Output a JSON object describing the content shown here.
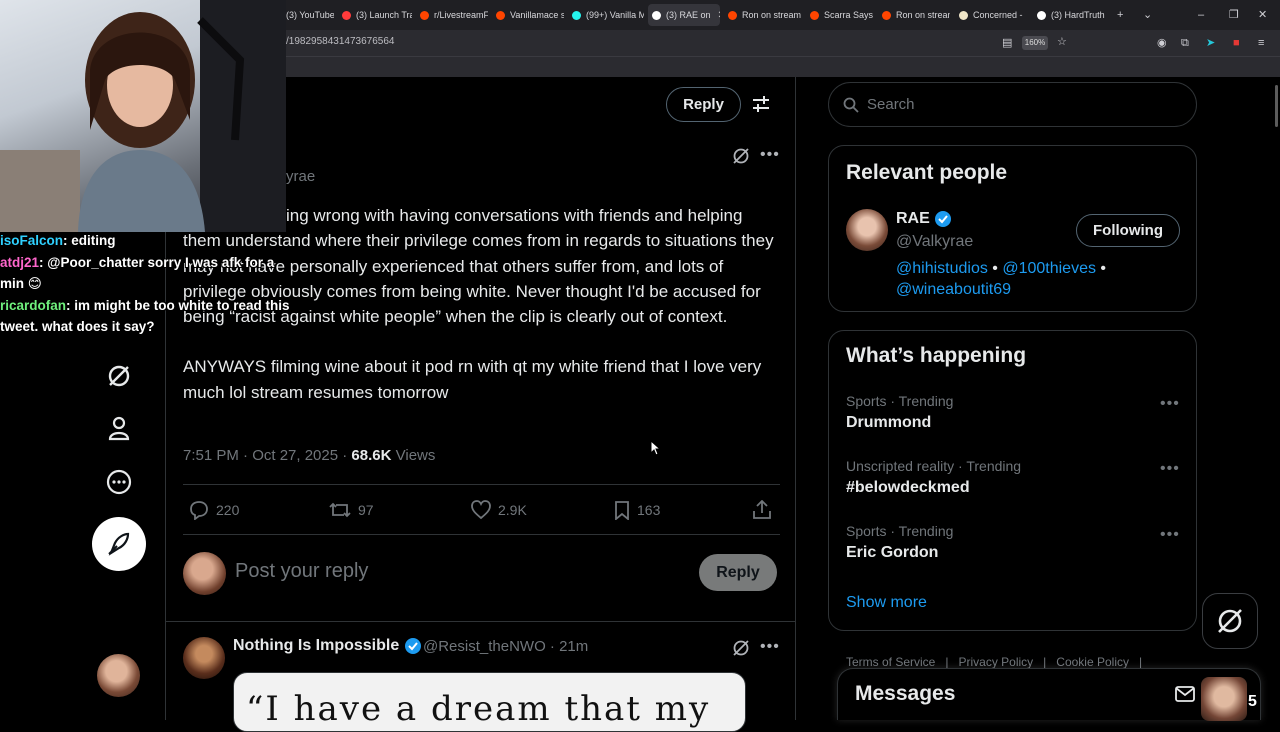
{
  "browser": {
    "tabs": [
      {
        "label": "(3) YouTube",
        "color": "#ff0000"
      },
      {
        "label": "(3) Launch Tra",
        "color": "#ff3b3b"
      },
      {
        "label": "r/LivestreamF",
        "color": "#ff4500"
      },
      {
        "label": "Vanillamace s",
        "color": "#ff4500"
      },
      {
        "label": "(99+) Vanilla M",
        "color": "#25f4ee"
      },
      {
        "label": "(3) RAE on",
        "color": "#ffffff"
      },
      {
        "label": "Ron on stream",
        "color": "#ff4500"
      },
      {
        "label": "Scarra Says H",
        "color": "#ff4500"
      },
      {
        "label": "Ron on stream",
        "color": "#ff4500"
      },
      {
        "label": "Concerned - ",
        "color": "#f0e6c8"
      },
      {
        "label": "(3) HardTruth",
        "color": "#ffffff"
      }
    ],
    "url": "/1982958431473676564",
    "zoom": "160%"
  },
  "header": {
    "reply_label": "Reply"
  },
  "tweet": {
    "handle_partial": "yrae",
    "paragraph1": "ing wrong with having conversations with friends and helping them understand where their privilege comes from in regards to situations they may not have personally experienced that others suffer from, and lots of privilege obviously comes from being white. Never thought I'd be accused for being “racist against white people” when the clip is clearly out of context.",
    "paragraph2": "ANYWAYS filming wine about it pod rn with qt my white friend that I love very much lol stream resumes tomorrow",
    "time": "7:51 PM · Oct 27, 2025 ·",
    "views_count": "68.6K",
    "views_label": "Views",
    "stats": {
      "replies": "220",
      "reposts": "97",
      "likes": "2.9K",
      "bookmarks": "163"
    }
  },
  "composer": {
    "placeholder": "Post your reply",
    "submit_label": "Reply"
  },
  "reply2": {
    "name": "Nothing Is Impossible",
    "handle_time": "@Resist_theNWO · 21m",
    "media_text": "“I have a dream that my"
  },
  "search": {
    "placeholder": "Search"
  },
  "relevant_people": {
    "title": "Relevant people",
    "name": "RAE",
    "handle": "@Valkyrae",
    "bio_links": [
      "@hihistudios",
      "@100thieves",
      "@wineaboutit69"
    ],
    "bio_separator": " • ",
    "follow_label": "Following"
  },
  "whats_happening": {
    "title": "What’s happening",
    "trends": [
      {
        "category": "Sports · Trending",
        "name": "Drummond"
      },
      {
        "category": "Unscripted reality · Trending",
        "name": "#belowdeckmed"
      },
      {
        "category": "Sports · Trending",
        "name": "Eric Gordon"
      }
    ],
    "show_more": "Show more"
  },
  "footer": [
    "Terms of Service",
    "|",
    "Privacy Policy",
    "|",
    "Cookie Policy",
    "|"
  ],
  "messages": {
    "title": "Messages",
    "count": "5"
  },
  "chat": [
    {
      "user": "isoFalcon",
      "text": "editing",
      "color": "blue"
    },
    {
      "user": "atdj21",
      "text": "@Poor_chatter sorry I was afk for a min 😊",
      "color": "pink"
    },
    {
      "user": "ricardofan",
      "text": "im might be too white to read this tweet. what does it say?",
      "color": "green"
    }
  ],
  "colors": {
    "accent": "#1d9bf0",
    "verified": "#1d9bf0",
    "background": "#000000",
    "muted": "#71767b"
  }
}
